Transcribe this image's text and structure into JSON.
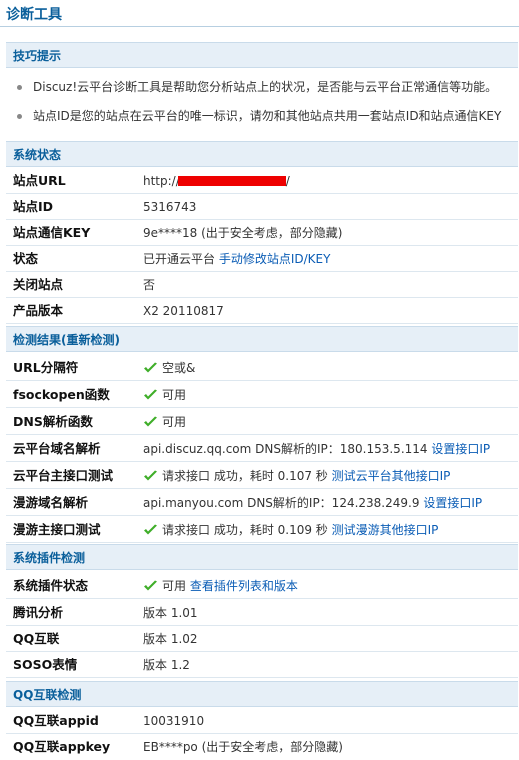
{
  "page_title": "诊断工具",
  "tips": {
    "title": "技巧提示",
    "items": [
      "Discuz!云平台诊断工具是帮助您分析站点上的状况，是否能与云平台正常通信等功能。",
      "站点ID是您的站点在云平台的唯一标识，请勿和其他站点共用一套站点ID和站点通信KEY"
    ]
  },
  "system_status": {
    "title": "系统状态",
    "site_url": {
      "label": "站点URL",
      "value": "http://",
      "tail": "/"
    },
    "site_id": {
      "label": "站点ID",
      "value": "5316743"
    },
    "site_key": {
      "label": "站点通信KEY",
      "value": "9e****18 (出于安全考虑，部分隐藏)"
    },
    "status": {
      "label": "状态",
      "value": "已开通云平台",
      "link": "手动修改站点ID/KEY"
    },
    "closed": {
      "label": "关闭站点",
      "value": "否"
    },
    "version": {
      "label": "产品版本",
      "value": "X2 20110817"
    }
  },
  "check_results": {
    "title_prefix": "检测结果(",
    "title_link": "重新检测",
    "title_suffix": ")",
    "url_sep": {
      "label": "URL分隔符",
      "value": "空或&"
    },
    "fsockopen": {
      "label": "fsockopen函数",
      "value": "可用"
    },
    "dns": {
      "label": "DNS解析函数",
      "value": "可用"
    },
    "cloud_dns": {
      "label": "云平台域名解析",
      "value": "api.discuz.qq.com DNS解析的IP：180.153.5.114",
      "link": "设置接口IP"
    },
    "cloud_api": {
      "label": "云平台主接口测试",
      "value": "请求接口 成功，耗时 0.107 秒",
      "link": "测试云平台其他接口IP"
    },
    "manyou_dns": {
      "label": "漫游域名解析",
      "value": "api.manyou.com DNS解析的IP：124.238.249.9",
      "link": "设置接口IP"
    },
    "manyou_api": {
      "label": "漫游主接口测试",
      "value": "请求接口 成功，耗时 0.109 秒",
      "link": "测试漫游其他接口IP"
    }
  },
  "plugin_check": {
    "title": "系统插件检测",
    "plugin_status": {
      "label": "系统插件状态",
      "value": "可用",
      "link": "查看插件列表和版本"
    },
    "tencent": {
      "label": "腾讯分析",
      "value": "版本 1.01"
    },
    "qqconnect": {
      "label": "QQ互联",
      "value": "版本 1.02"
    },
    "soso": {
      "label": "SOSO表情",
      "value": "版本 1.2"
    }
  },
  "qq_check": {
    "title": "QQ互联检测",
    "appid": {
      "label": "QQ互联appid",
      "value": "10031910"
    },
    "appkey": {
      "label": "QQ互联appkey",
      "value": "EB****po (出于安全考虑，部分隐藏)"
    }
  },
  "colors": {
    "accent": "#0a5f9b",
    "link": "#0a5cb5",
    "section_bg": "#e6eff7",
    "check": "#3fae29",
    "redact": "#ee0000"
  }
}
